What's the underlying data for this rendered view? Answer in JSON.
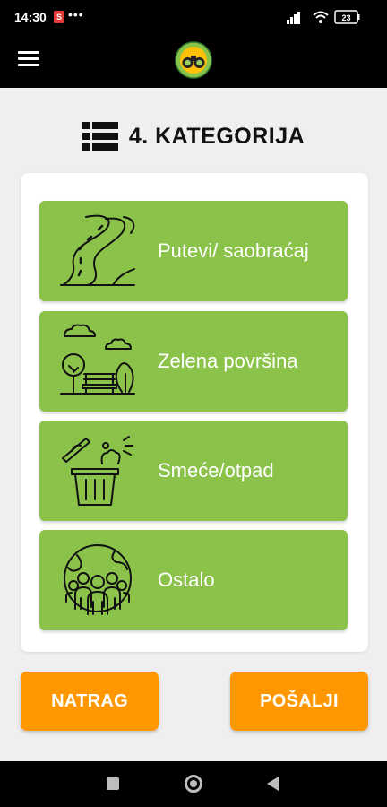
{
  "status_bar": {
    "time": "14:30",
    "app_badge": "S",
    "more": "•••",
    "battery": "23"
  },
  "app_bar": {
    "menu_icon": "hamburger-menu-icon",
    "logo_icon": "binoculars-logo-icon"
  },
  "page": {
    "title": "4. KATEGORIJA",
    "title_icon": "list-icon"
  },
  "categories": [
    {
      "label": "Putevi/ saobraćaj",
      "icon": "road-icon"
    },
    {
      "label": "Zelena površina",
      "icon": "park-icon"
    },
    {
      "label": "Smeće/otpad",
      "icon": "trash-bin-icon"
    },
    {
      "label": "Ostalo",
      "icon": "people-globe-icon"
    }
  ],
  "buttons": {
    "back": "NATRAG",
    "send": "POŠALJI"
  },
  "colors": {
    "category_bg": "#8bc34a",
    "button_bg": "#ff9800",
    "bar_bg": "#000000",
    "page_bg": "#efefef"
  }
}
